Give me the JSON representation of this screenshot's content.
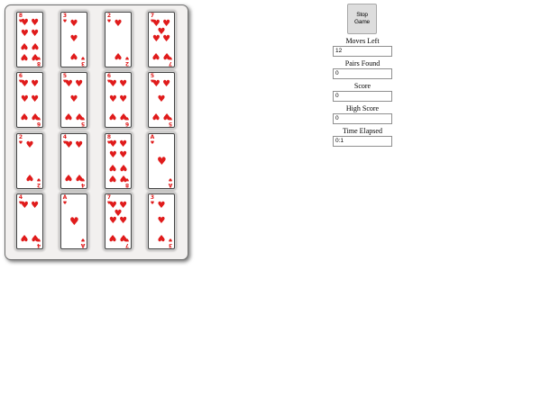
{
  "controls": {
    "stop_button_label": "Stop Game"
  },
  "stats": [
    {
      "key": "moves_left",
      "label": "Moves Left",
      "value": "12"
    },
    {
      "key": "pairs_found",
      "label": "Pairs Found",
      "value": "0"
    },
    {
      "key": "score",
      "label": "Score",
      "value": "0"
    },
    {
      "key": "high_score",
      "label": "High Score",
      "value": "0"
    },
    {
      "key": "time_elapsed",
      "label": "Time Elapsed",
      "value": "0:1"
    }
  ],
  "board": {
    "suit_symbol": "♥",
    "suit_color": "#e01b1b",
    "cards": [
      {
        "rank": "8",
        "count": 8
      },
      {
        "rank": "3",
        "count": 3
      },
      {
        "rank": "2",
        "count": 2
      },
      {
        "rank": "7",
        "count": 7
      },
      {
        "rank": "6",
        "count": 6
      },
      {
        "rank": "5",
        "count": 5
      },
      {
        "rank": "6",
        "count": 6
      },
      {
        "rank": "5",
        "count": 5
      },
      {
        "rank": "2",
        "count": 2
      },
      {
        "rank": "4",
        "count": 4
      },
      {
        "rank": "8",
        "count": 8
      },
      {
        "rank": "A",
        "count": 1
      },
      {
        "rank": "4",
        "count": 4
      },
      {
        "rank": "A",
        "count": 1
      },
      {
        "rank": "7",
        "count": 7
      },
      {
        "rank": "3",
        "count": 3
      }
    ]
  }
}
